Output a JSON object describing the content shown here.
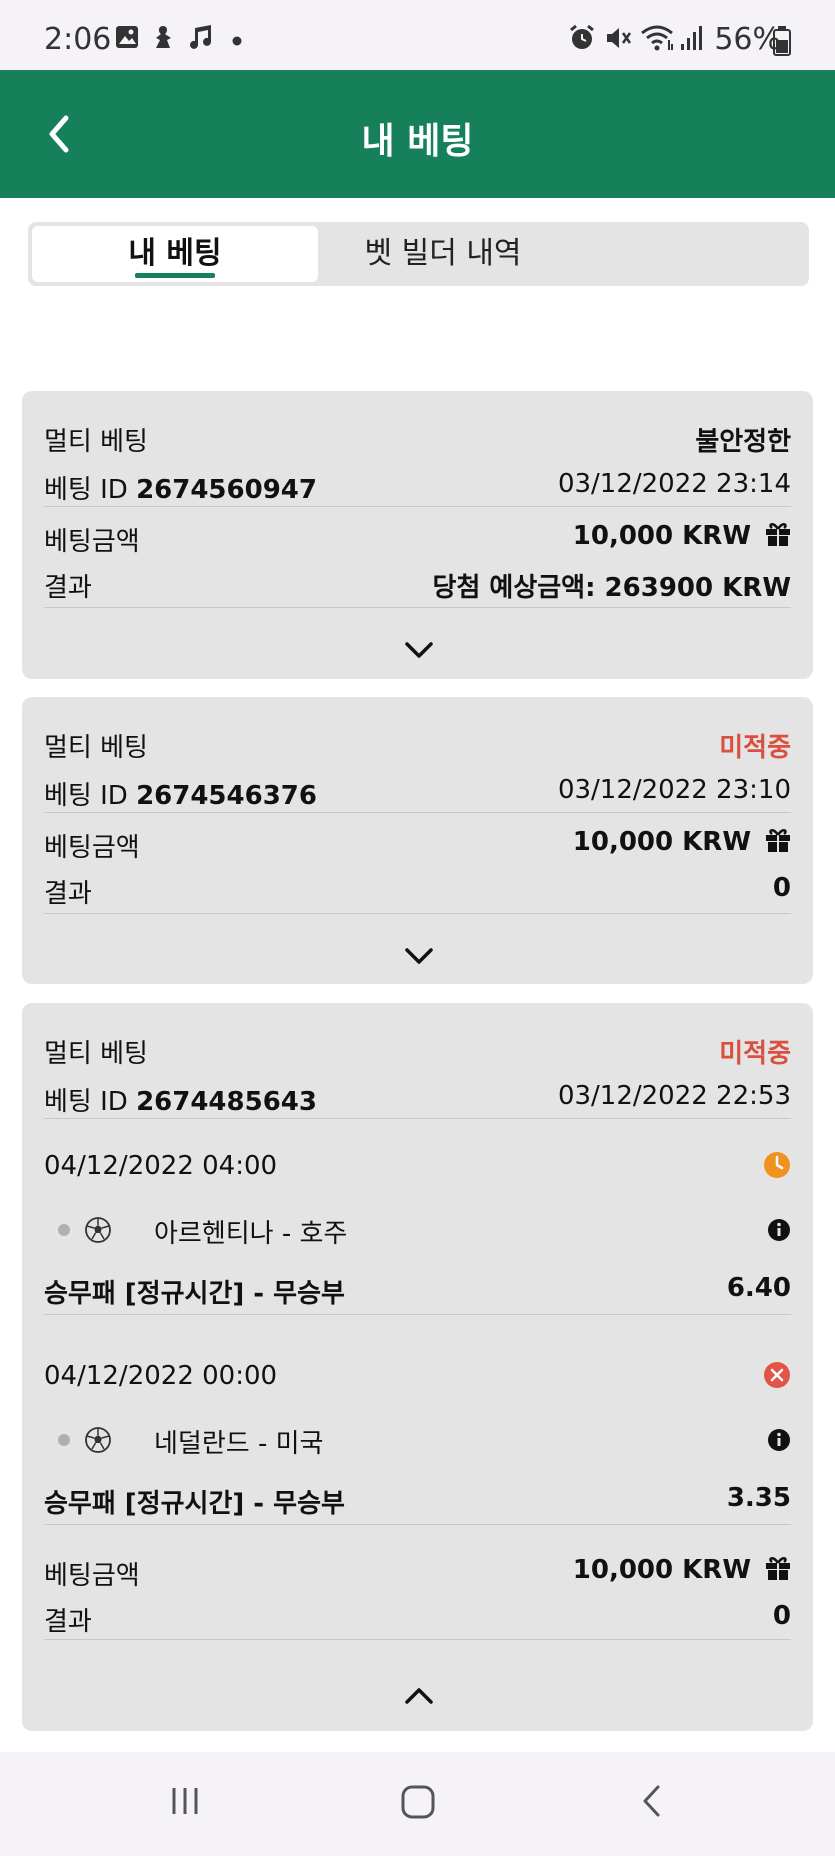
{
  "status_bar": {
    "time": "2:06",
    "battery_percent": "56%",
    "icons": [
      "gallery-icon",
      "download-icon",
      "music-icon",
      "dot-icon",
      "alarm-icon",
      "mute-icon",
      "wifi-icon",
      "signal-icon",
      "battery-icon"
    ]
  },
  "app_bar": {
    "title": "내 베팅",
    "back_icon": "chevron-left-icon"
  },
  "tabs": [
    {
      "label": "내 베팅",
      "active": true
    },
    {
      "label": "벳 빌더 내역",
      "active": false
    }
  ],
  "bets": [
    {
      "type": "멀티 베팅",
      "status": "불안정한",
      "id_label": "베팅 ID",
      "id": "2674560947",
      "datetime": "03/12/2022 23:14",
      "stake_label": "베팅금액",
      "stake": "10,000 KRW",
      "result_label": "결과",
      "result": "당첨 예상금액: 263900 KRW",
      "expanded": false
    },
    {
      "type": "멀티 베팅",
      "status": "미적중",
      "id_label": "베팅 ID",
      "id": "2674546376",
      "datetime": "03/12/2022 23:10",
      "stake_label": "베팅금액",
      "stake": "10,000 KRW",
      "result_label": "결과",
      "result": "0",
      "expanded": false
    },
    {
      "type": "멀티 베팅",
      "status": "미적중",
      "id_label": "베팅 ID",
      "id": "2674485643",
      "datetime": "03/12/2022 22:53",
      "selections": [
        {
          "datetime": "04/12/2022 04:00",
          "state_icon": "clock-icon",
          "state_color": "#f0931e",
          "match": "아르헨티나 - 호주",
          "market": "승무패 [정규시간] - 무승부",
          "odds": "6.40"
        },
        {
          "datetime": "04/12/2022 00:00",
          "state_icon": "lost-x-icon",
          "state_color": "#e05545",
          "match": "네덜란드 - 미국",
          "market": "승무패 [정규시간] - 무승부",
          "odds": "3.35"
        }
      ],
      "stake_label": "베팅금액",
      "stake": "10,000 KRW",
      "result_label": "결과",
      "result": "0",
      "expanded": true
    }
  ],
  "colors": {
    "brand_green": "#16805a",
    "lost_red": "#d9503f",
    "card_bg": "#e4e4e4"
  },
  "nav_bar": [
    "recents-icon",
    "home-icon",
    "back-icon"
  ]
}
